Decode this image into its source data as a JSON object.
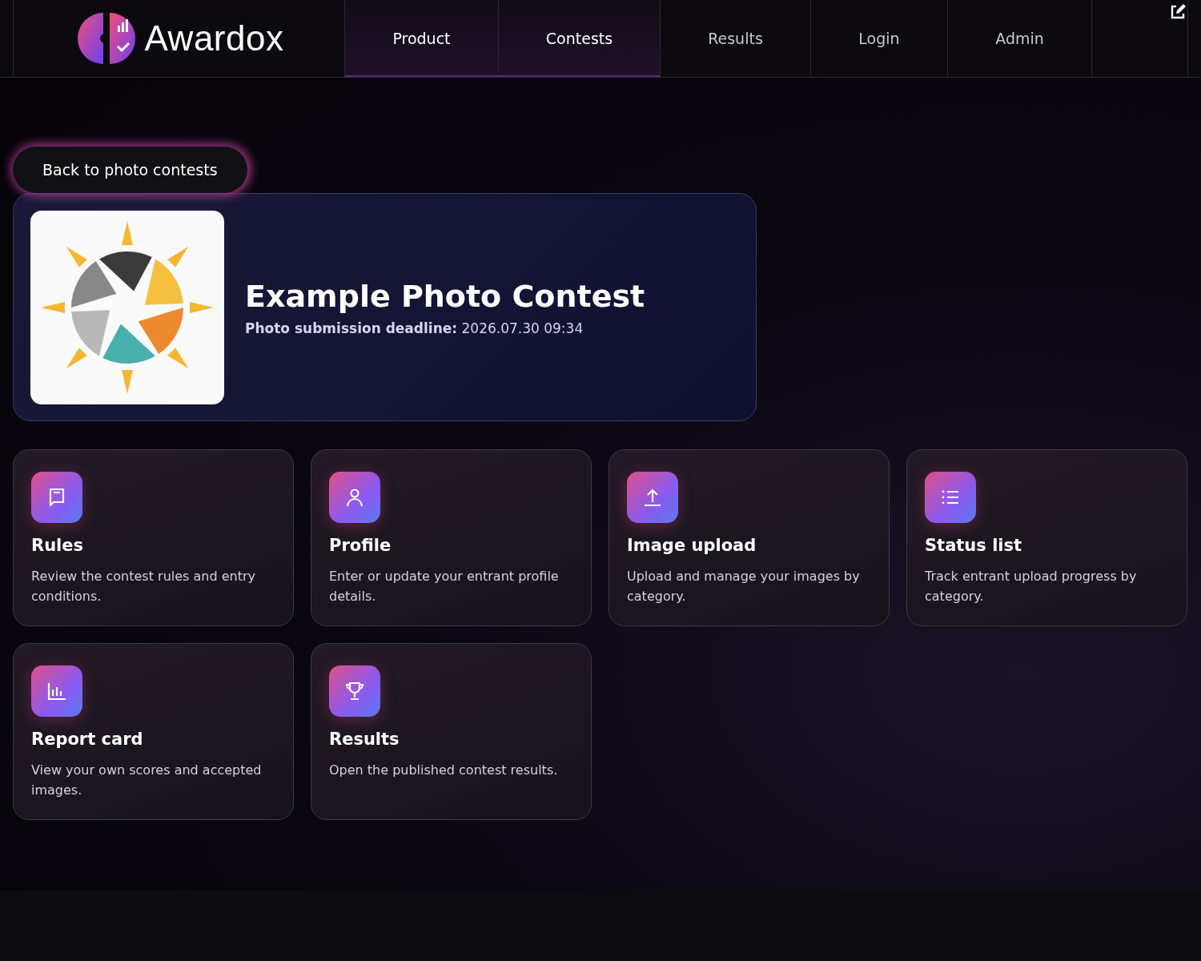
{
  "header": {
    "brand": "Awardox",
    "nav": [
      {
        "label": "Product",
        "highlighted": true
      },
      {
        "label": "Contests",
        "highlighted": true
      },
      {
        "label": "Results",
        "highlighted": false
      },
      {
        "label": "Login",
        "highlighted": false
      },
      {
        "label": "Admin",
        "highlighted": false
      }
    ]
  },
  "back_button": "Back to photo contests",
  "contest": {
    "title": "Example Photo Contest",
    "deadline_label": "Photo submission deadline:",
    "deadline": "2026.07.30 09:34"
  },
  "cards": [
    {
      "kind": "rules",
      "title": "Rules",
      "text": "Review the contest rules and entry conditions."
    },
    {
      "kind": "profile",
      "title": "Profile",
      "text": "Enter or update your entrant profile details."
    },
    {
      "kind": "upload",
      "title": "Image upload",
      "text": "Upload and manage your images by category."
    },
    {
      "kind": "status",
      "title": "Status list",
      "text": "Track entrant upload progress by category."
    },
    {
      "kind": "report",
      "title": "Report card",
      "text": "View your own scores and accepted images."
    },
    {
      "kind": "results",
      "title": "Results",
      "text": "Open the published contest results."
    }
  ]
}
